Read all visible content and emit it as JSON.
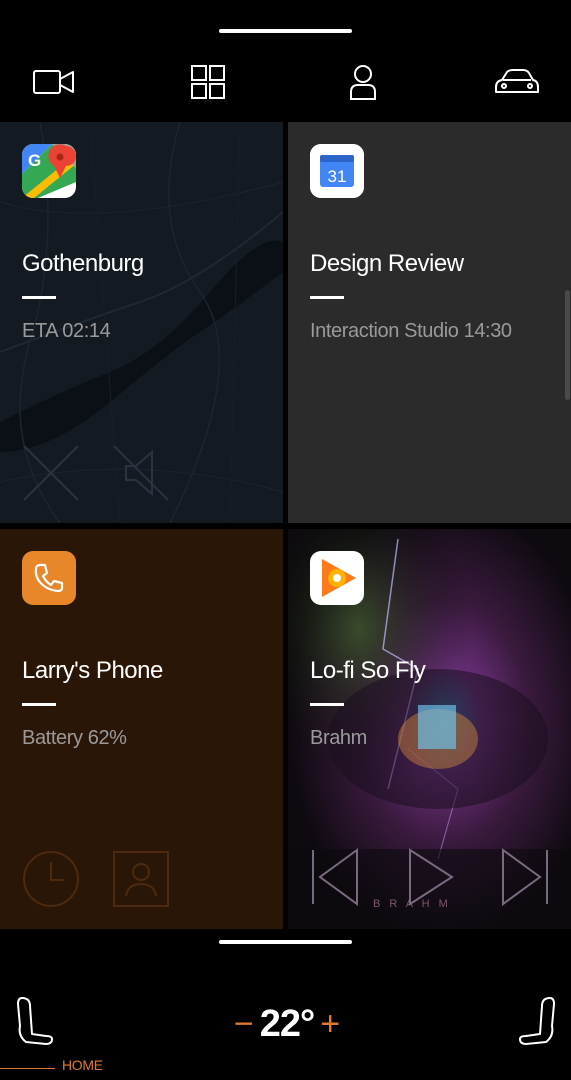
{
  "top_nav": {
    "items": [
      {
        "icon": "video-camera-icon"
      },
      {
        "icon": "app-grid-icon"
      },
      {
        "icon": "user-profile-icon"
      },
      {
        "icon": "car-icon"
      }
    ]
  },
  "tiles": {
    "maps": {
      "app": "google-maps-icon",
      "title": "Gothenburg",
      "subtitle": "ETA 02:14",
      "actions": [
        "close-icon",
        "mute-icon"
      ]
    },
    "calendar": {
      "app": "google-calendar-icon",
      "app_glyph": "31",
      "title": "Design Review",
      "subtitle": "Interaction Studio 14:30"
    },
    "phone": {
      "app": "phone-icon",
      "title": "Larry's Phone",
      "subtitle": "Battery 62%",
      "actions": [
        "recent-calls-icon",
        "contacts-icon"
      ]
    },
    "music": {
      "app": "google-play-music-icon",
      "title": "Lo-fi So Fly",
      "subtitle": "Brahm",
      "album_text": "B R A H M",
      "actions": [
        "previous-track-icon",
        "play-icon",
        "next-track-icon"
      ]
    }
  },
  "climate": {
    "temperature": "22°",
    "decrease": "−",
    "increase": "+"
  },
  "bottom_nav": {
    "home_label": "HOME"
  },
  "colors": {
    "accent": "#e07a2e",
    "background": "#000000",
    "maps_tile": "#141a22",
    "calendar_tile": "#2b2b2b",
    "phone_tile": "#2a1606",
    "phone_app": "#e8862a"
  }
}
